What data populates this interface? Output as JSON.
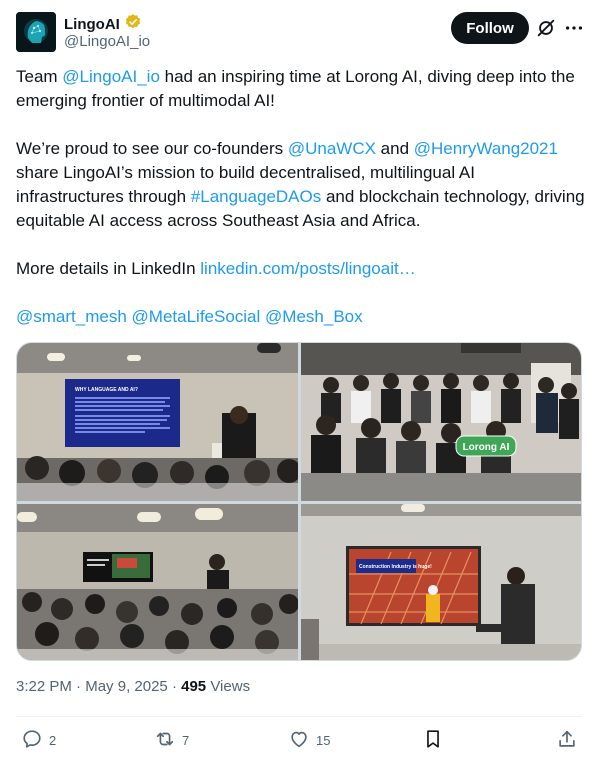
{
  "author": {
    "name": "LingoAI",
    "handle": "@LingoAI_io",
    "verified_icon": "gold-verified-badge"
  },
  "header": {
    "follow_label": "Follow",
    "grok_icon": "grok-icon",
    "more_icon": "more-icon"
  },
  "tweet": {
    "line1_pre": "Team ",
    "line1_mention": "@LingoAI_io",
    "line1_post": " had an inspiring time at Lorong AI, diving deep into the emerging frontier of multimodal AI!",
    "line2_pre": "We’re proud to see our co-founders ",
    "line2_mention1": "@UnaWCX",
    "line2_and": " and ",
    "line2_mention2": "@HenryWang2021",
    "line2_mid": " share LingoAI’s mission to build decentralised, multilingual AI infrastructures through ",
    "line2_hashtag": "#LanguageDAOs",
    "line2_post": " and blockchain technology, driving equitable AI access across Southeast Asia and Africa.",
    "line3_pre": "More details in LinkedIn ",
    "line3_link": "linkedin.com/posts/lingoait…",
    "mention_a": "@smart_mesh",
    "mention_b": "@MetaLifeSocial",
    "mention_c": "@Mesh_Box"
  },
  "media": {
    "photo1_slide_title": "WHY LANGUAGE AND AI?",
    "photo2_sign": "Lorong AI",
    "photo4_slide_title": "Construction Industry is huge!"
  },
  "meta": {
    "time": "3:22 PM",
    "separator": " · ",
    "date": "May 9, 2025",
    "views_count": "495",
    "views_label": " Views"
  },
  "actions": {
    "replies": "2",
    "reposts": "7",
    "likes": "15"
  },
  "colors": {
    "link": "#1d9bf0",
    "text": "#0f1419",
    "secondary": "#536471",
    "verified": "#e2b719"
  }
}
